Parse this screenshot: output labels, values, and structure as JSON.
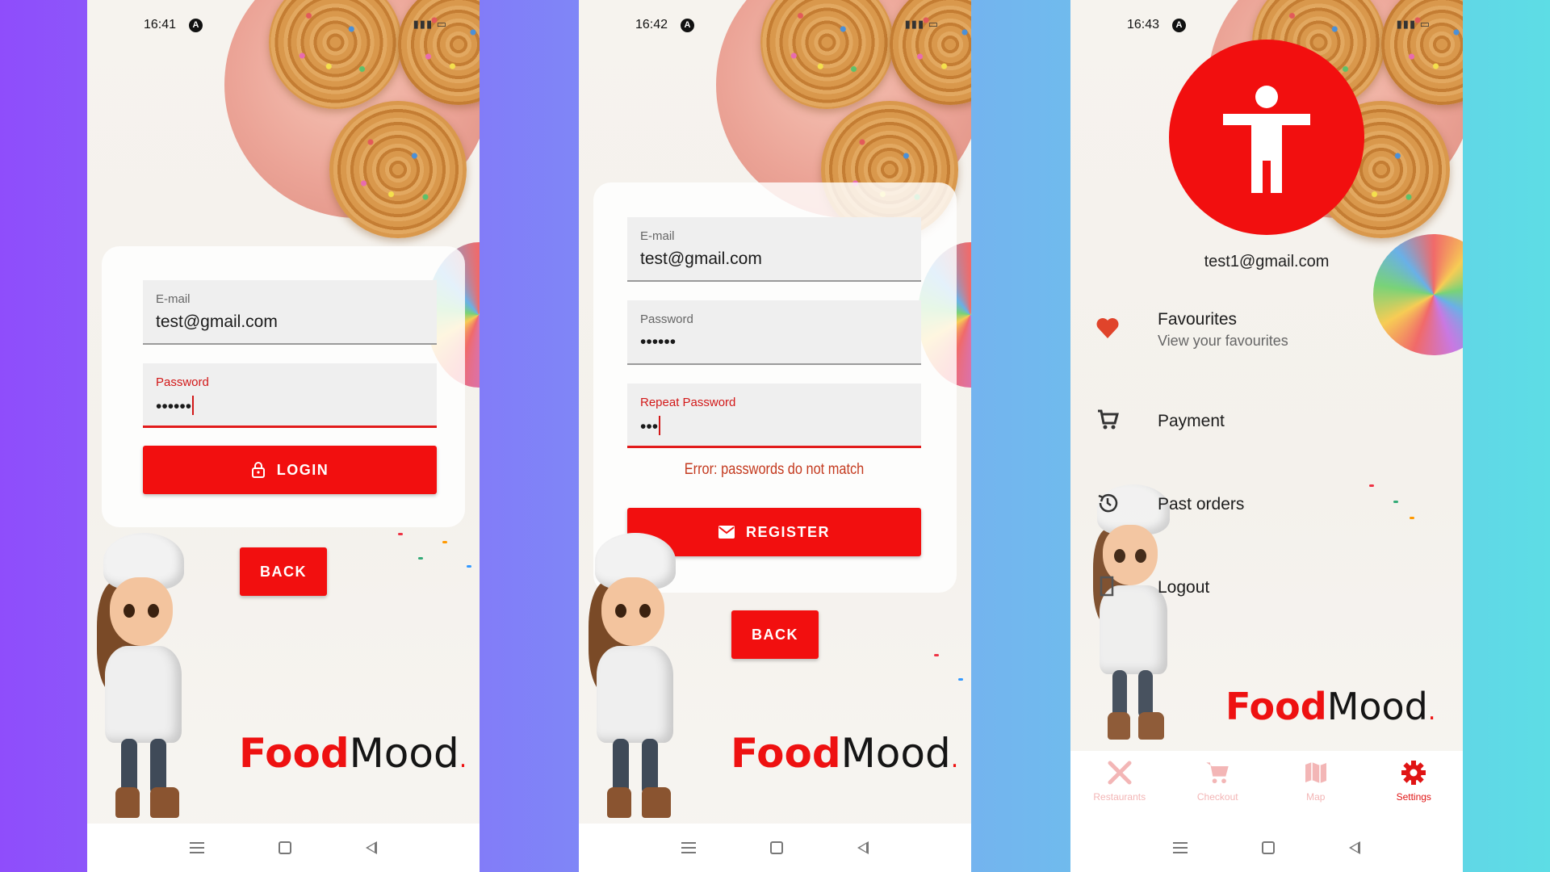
{
  "colors": {
    "accent": "#f20f0f",
    "error": "#c43a1f",
    "tab_inactive": "#f3b6b6"
  },
  "brand": {
    "food": "Food",
    "mood": "Mood",
    "dot": "."
  },
  "screens": {
    "login": {
      "status_time": "16:41",
      "email": {
        "label": "E-mail",
        "value": "test@gmail.com"
      },
      "password": {
        "label": "Password",
        "value": "••••••"
      },
      "login_button": {
        "label": "LOGIN",
        "icon": "lock-icon"
      },
      "back_button": "BACK"
    },
    "register": {
      "status_time": "16:42",
      "email": {
        "label": "E-mail",
        "value": "test@gmail.com"
      },
      "password": {
        "label": "Password",
        "value": "••••••"
      },
      "repeat_password": {
        "label": "Repeat Password",
        "value": "•••"
      },
      "error": "Error: passwords do not match",
      "register_button": {
        "label": "REGISTER",
        "icon": "mail-icon"
      },
      "back_button": "BACK"
    },
    "settings": {
      "status_time": "16:43",
      "user_email": "test1@gmail.com",
      "menu": [
        {
          "title": "Favourites",
          "subtitle": "View your favourites",
          "icon": "heart-icon"
        },
        {
          "title": "Payment",
          "icon": "cart-icon"
        },
        {
          "title": "Past orders",
          "icon": "history-icon"
        },
        {
          "title": "Logout",
          "icon": "logout-icon"
        }
      ],
      "tabs": [
        {
          "label": "Restaurants",
          "icon": "utensils-icon",
          "active": false
        },
        {
          "label": "Checkout",
          "icon": "cart-icon",
          "active": false
        },
        {
          "label": "Map",
          "icon": "map-icon",
          "active": false
        },
        {
          "label": "Settings",
          "icon": "gear-icon",
          "active": true
        }
      ]
    }
  }
}
